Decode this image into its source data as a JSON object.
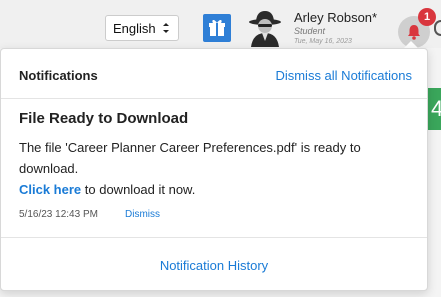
{
  "header": {
    "language": "English",
    "user": {
      "name": "Arley Robson*",
      "role": "Student",
      "date": "Tue, May 16, 2023"
    },
    "notification_count": "1",
    "partial_tile_text": "4"
  },
  "notifications": {
    "title": "Notifications",
    "dismiss_all_label": "Dismiss all Notifications",
    "items": [
      {
        "title": "File Ready to Download",
        "body": "The file 'Career Planner Career Preferences.pdf' is ready to download.",
        "link_label": "Click here",
        "link_suffix": " to download it now.",
        "timestamp": "5/16/23 12:43 PM",
        "dismiss_label": "Dismiss"
      }
    ],
    "history_label": "Notification History"
  },
  "colors": {
    "link": "#1a7bd6",
    "gift": "#2f7fd6",
    "badge": "#d9363e",
    "green_tile": "#3aa65b"
  }
}
